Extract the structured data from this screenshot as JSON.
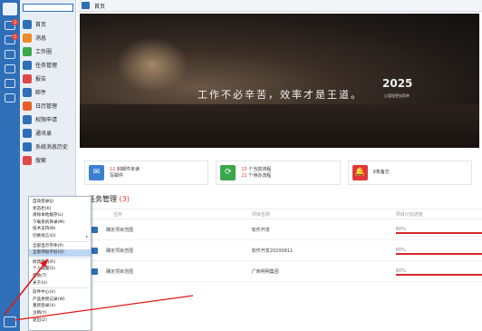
{
  "sidebar": {
    "search_placeholder": "",
    "items": [
      {
        "label": "首页",
        "color": "#2f6fb8"
      },
      {
        "label": "消息",
        "color": "#f08a24"
      },
      {
        "label": "工作圈",
        "color": "#3aa84a"
      },
      {
        "label": "任务管理",
        "color": "#2f6fb8"
      },
      {
        "label": "报告",
        "color": "#e04848"
      },
      {
        "label": "邮件",
        "color": "#2f6fb8"
      },
      {
        "label": "日历管理",
        "color": "#e85d2a"
      },
      {
        "label": "权限申请",
        "color": "#2f6fb8"
      },
      {
        "label": "通讯录",
        "color": "#2f6fb8"
      },
      {
        "label": "系统消息历史",
        "color": "#2f6fb8"
      },
      {
        "label": "搜索",
        "color": "#e04848"
      }
    ],
    "strip_badges": [
      "3",
      "5"
    ]
  },
  "topbar": {
    "title": "首页"
  },
  "banner": {
    "slogan": "工作不必辛苦，效率才是王道。",
    "year": "2025",
    "year_sub": "让管理更加简单"
  },
  "cards": [
    {
      "icon": "mail-icon",
      "color": "#3b7fd1",
      "line1_num": "12",
      "line1_text": "封邮件未读",
      "line2": "写邮件"
    },
    {
      "icon": "workflow-icon",
      "color": "#3aa84a",
      "line1_num": "15",
      "line1_text": "个当前流程",
      "line2_num": "11",
      "line2_text": "个待办流程"
    },
    {
      "icon": "bell-icon",
      "color": "#e0383a",
      "line1_num": "",
      "line1_text": "0条备忘",
      "line2": ""
    }
  ],
  "tasks": {
    "title": "任务管理",
    "count": "(3)",
    "columns": [
      "任务",
      "项目名称",
      "项目计划进度"
    ],
    "rows": [
      {
        "task": "确定项目范围",
        "project": "软件开发",
        "progress_label": "60%",
        "progress": 0.6
      },
      {
        "task": "确定项目范围",
        "project": "软件开发20200811",
        "progress_label": "60%",
        "progress": 0.6
      },
      {
        "task": "确定项目范围",
        "project": "广西明明集团",
        "progress_label": "60%",
        "progress": 0.6
      }
    ]
  },
  "menu": {
    "items": [
      {
        "label": "自动登录(J)"
      },
      {
        "label": "状态栏(K)"
      },
      {
        "label": "清除本地缓存(L)"
      },
      {
        "label": "下载系统目录(M)"
      },
      {
        "label": "技术支持(N)"
      },
      {
        "label": "切换语言(O)",
        "submenu": true
      },
      {
        "sep": true
      },
      {
        "label": "全部显示字体(P)"
      },
      {
        "label": "全部添加字段(Q)",
        "selected": true
      },
      {
        "sep": true
      },
      {
        "label": "修改密码(R)"
      },
      {
        "label": "个人设置(S)"
      },
      {
        "label": "帮助(T)"
      },
      {
        "label": "关于(U)"
      },
      {
        "sep": true
      },
      {
        "label": "软件中心(V)"
      },
      {
        "label": "产品更新记录(W)"
      },
      {
        "label": "重新登录(X)"
      },
      {
        "label": "注销(Y)"
      },
      {
        "label": "退出(Z)"
      }
    ]
  }
}
